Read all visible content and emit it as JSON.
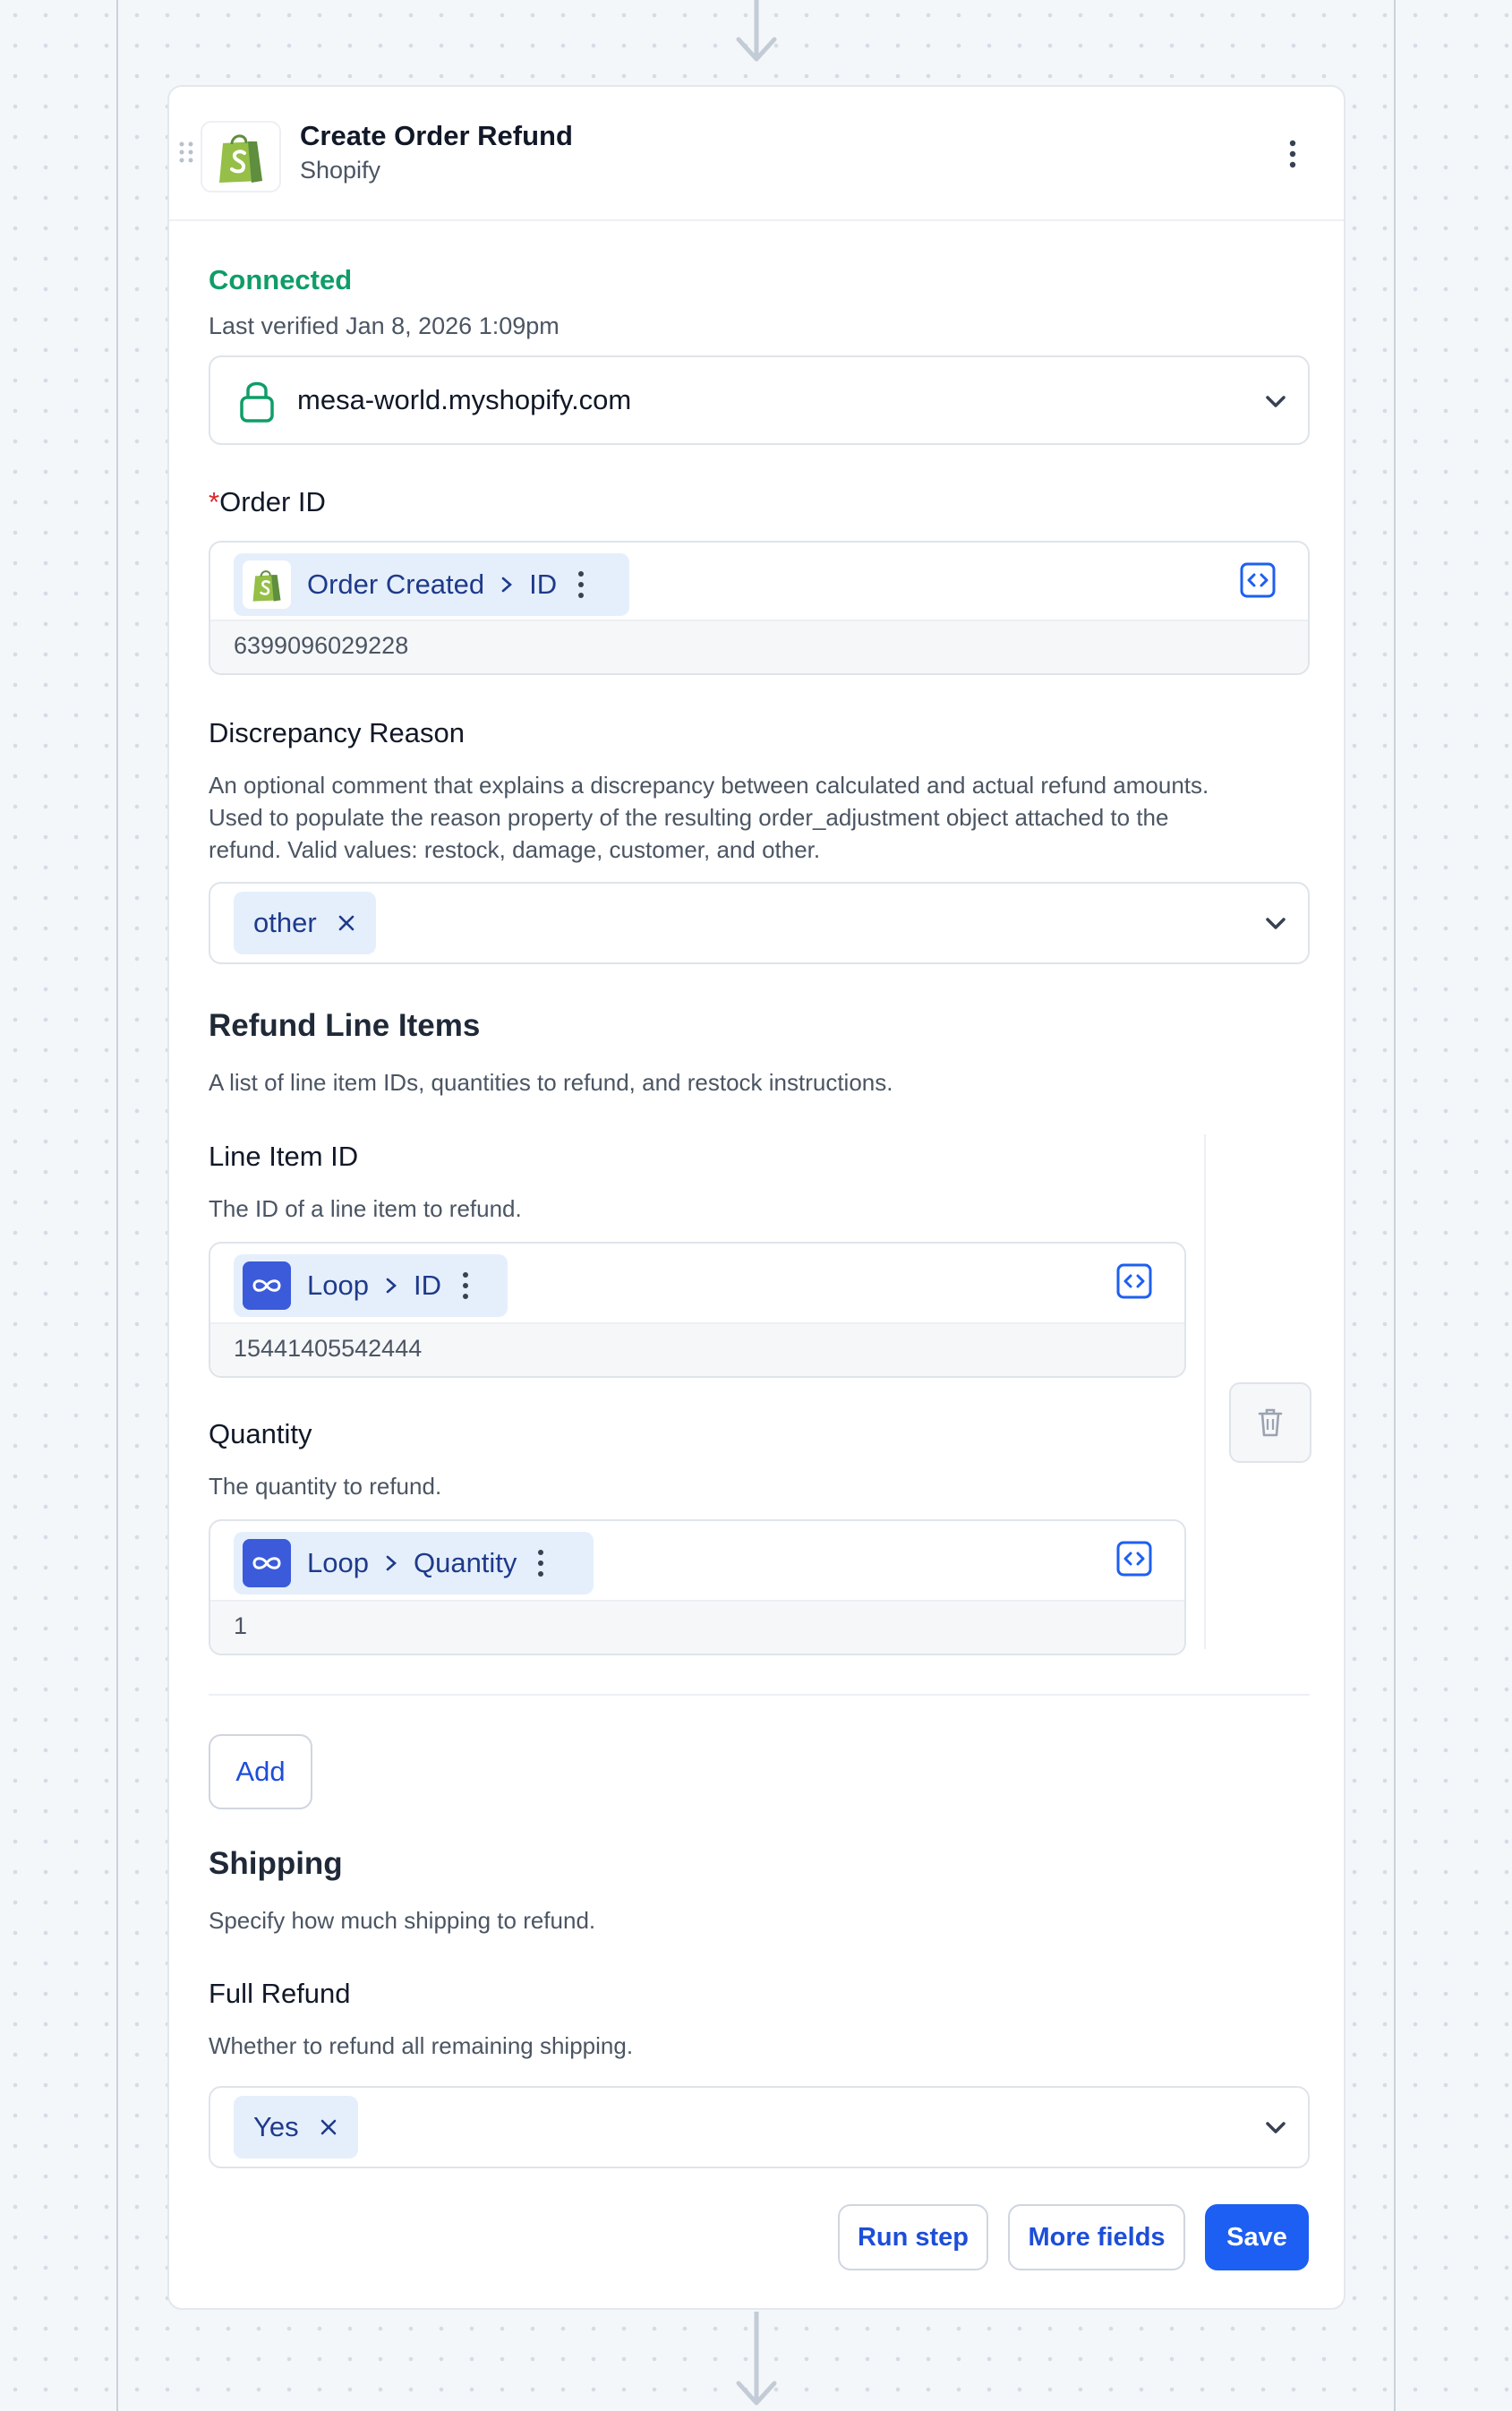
{
  "step": {
    "title": "Create Order Refund",
    "app": "Shopify"
  },
  "connection": {
    "status": "Connected",
    "verified": "Last verified Jan 8, 2026 1:09pm",
    "store": "mesa-world.myshopify.com"
  },
  "order_id": {
    "required_mark": "*",
    "label": "Order ID",
    "pill_source": "Order Created",
    "pill_field": "ID",
    "preview": "6399096029228"
  },
  "discrepancy": {
    "label": "Discrepancy Reason",
    "help": "An optional comment that explains a discrepancy between calculated and actual refund amounts. Used to populate the reason property of the resulting order_adjustment object attached to the refund. Valid values: restock, damage, customer, and other.",
    "value": "other"
  },
  "refund_line_items": {
    "title": "Refund Line Items",
    "help": "A list of line item IDs, quantities to refund, and restock instructions.",
    "line_item_id": {
      "label": "Line Item ID",
      "help": "The ID of a line item to refund.",
      "pill_source": "Loop",
      "pill_field": "ID",
      "preview": "15441405542444"
    },
    "quantity": {
      "label": "Quantity",
      "help": "The quantity to refund.",
      "pill_source": "Loop",
      "pill_field": "Quantity",
      "preview": "1"
    },
    "add_label": "Add"
  },
  "shipping": {
    "title": "Shipping",
    "help": "Specify how much shipping to refund.",
    "full_refund": {
      "label": "Full Refund",
      "help": "Whether to refund all remaining shipping.",
      "value": "Yes"
    }
  },
  "actions": {
    "run_step": "Run step",
    "more_fields": "More fields",
    "save": "Save"
  },
  "colors": {
    "connected": "#0f9d68",
    "primary": "#1d5ff2",
    "pill_bg": "#e5effc",
    "pill_text": "#1e3a8a",
    "shopify_green": "#95bf47"
  }
}
